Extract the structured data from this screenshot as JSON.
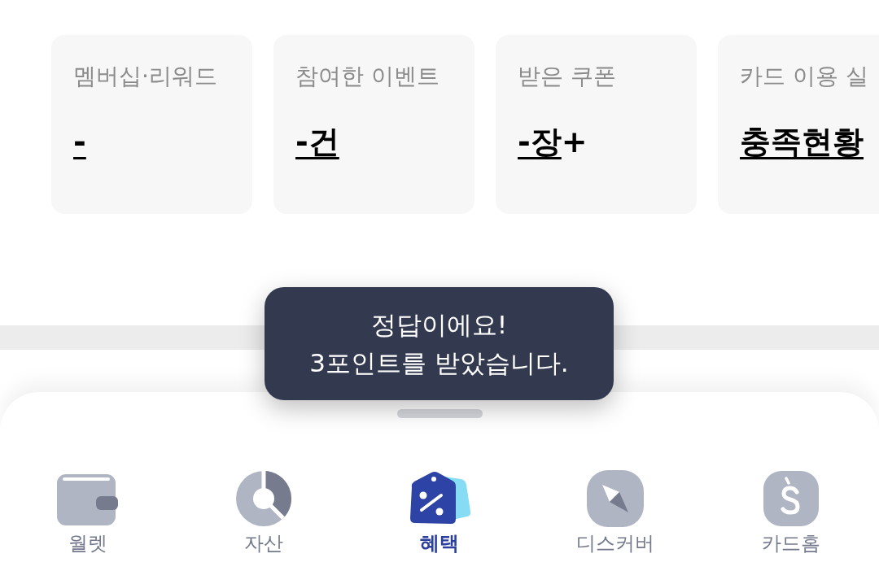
{
  "cards": [
    {
      "label": "멤버십·리워드",
      "value": "-"
    },
    {
      "label": "참여한 이벤트",
      "value": "-건"
    },
    {
      "label": "받은 쿠폰",
      "value": "-장",
      "suffix": "+"
    },
    {
      "label": "카드 이용 실",
      "value": "충족현황"
    }
  ],
  "toast": {
    "message": "정답이에요!\n3포인트를 받았습니다."
  },
  "bottom_nav": [
    {
      "label": "월렛",
      "selected": false
    },
    {
      "label": "자산",
      "selected": false
    },
    {
      "label": "혜택",
      "selected": true
    },
    {
      "label": "디스커버",
      "selected": false
    },
    {
      "label": "카드홈",
      "selected": false
    }
  ]
}
